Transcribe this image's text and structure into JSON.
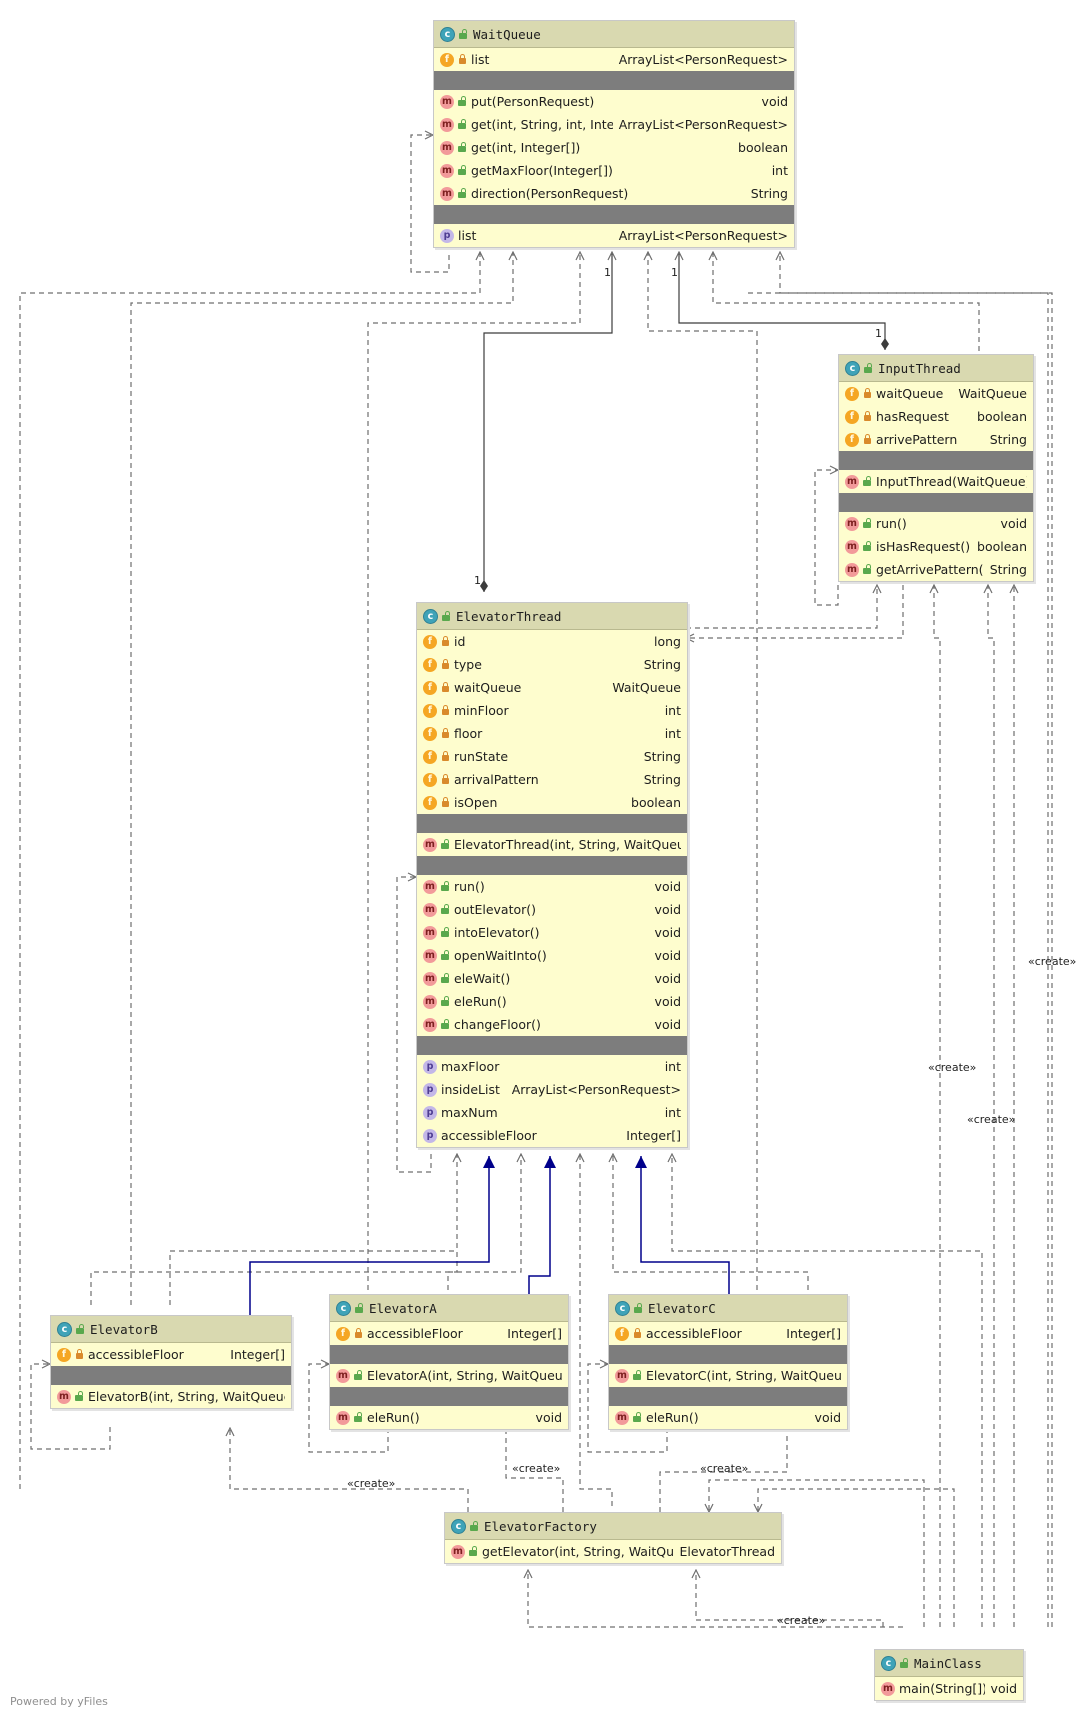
{
  "footer": "Powered by yFiles",
  "classes": {
    "waitqueue": {
      "name": "WaitQueue",
      "fields": [
        {
          "name": "list",
          "type": "ArrayList<PersonRequest>"
        }
      ],
      "methods": [
        {
          "name": "put(PersonRequest)",
          "type": "void"
        },
        {
          "name": "get(int, String, int, Integer[])",
          "type": "ArrayList<PersonRequest>"
        },
        {
          "name": "get(int, Integer[])",
          "type": "boolean"
        },
        {
          "name": "getMaxFloor(Integer[])",
          "type": "int"
        },
        {
          "name": "direction(PersonRequest)",
          "type": "String"
        }
      ],
      "properties": [
        {
          "name": "list",
          "type": "ArrayList<PersonRequest>"
        }
      ]
    },
    "inputthread": {
      "name": "InputThread",
      "fields": [
        {
          "name": "waitQueue",
          "type": "WaitQueue"
        },
        {
          "name": "hasRequest",
          "type": "boolean"
        },
        {
          "name": "arrivePattern",
          "type": "String"
        }
      ],
      "constructors": [
        {
          "name": "InputThread(WaitQueue)",
          "type": ""
        }
      ],
      "methods": [
        {
          "name": "run()",
          "type": "void"
        },
        {
          "name": "isHasRequest()",
          "type": "boolean"
        },
        {
          "name": "getArrivePattern()",
          "type": "String"
        }
      ]
    },
    "elevatorthread": {
      "name": "ElevatorThread",
      "fields": [
        {
          "name": "id",
          "type": "long"
        },
        {
          "name": "type",
          "type": "String"
        },
        {
          "name": "waitQueue",
          "type": "WaitQueue"
        },
        {
          "name": "minFloor",
          "type": "int"
        },
        {
          "name": "floor",
          "type": "int"
        },
        {
          "name": "runState",
          "type": "String"
        },
        {
          "name": "arrivalPattern",
          "type": "String"
        },
        {
          "name": "isOpen",
          "type": "boolean"
        }
      ],
      "constructors": [
        {
          "name": "ElevatorThread(int, String, WaitQueue)",
          "type": ""
        }
      ],
      "methods": [
        {
          "name": "run()",
          "type": "void"
        },
        {
          "name": "outElevator()",
          "type": "void"
        },
        {
          "name": "intoElevator()",
          "type": "void"
        },
        {
          "name": "openWaitInto()",
          "type": "void"
        },
        {
          "name": "eleWait()",
          "type": "void"
        },
        {
          "name": "eleRun()",
          "type": "void"
        },
        {
          "name": "changeFloor()",
          "type": "void"
        }
      ],
      "properties": [
        {
          "name": "maxFloor",
          "type": "int"
        },
        {
          "name": "insideList",
          "type": "ArrayList<PersonRequest>"
        },
        {
          "name": "maxNum",
          "type": "int"
        },
        {
          "name": "accessibleFloor",
          "type": "Integer[]"
        }
      ]
    },
    "elevatorb": {
      "name": "ElevatorB",
      "fields": [
        {
          "name": "accessibleFloor",
          "type": "Integer[]"
        }
      ],
      "constructors": [
        {
          "name": "ElevatorB(int, String, WaitQueue)",
          "type": ""
        }
      ]
    },
    "elevatora": {
      "name": "ElevatorA",
      "fields": [
        {
          "name": "accessibleFloor",
          "type": "Integer[]"
        }
      ],
      "constructors": [
        {
          "name": "ElevatorA(int, String, WaitQueue)",
          "type": ""
        }
      ],
      "methods": [
        {
          "name": "eleRun()",
          "type": "void"
        }
      ]
    },
    "elevatorc": {
      "name": "ElevatorC",
      "fields": [
        {
          "name": "accessibleFloor",
          "type": "Integer[]"
        }
      ],
      "constructors": [
        {
          "name": "ElevatorC(int, String, WaitQueue)",
          "type": ""
        }
      ],
      "methods": [
        {
          "name": "eleRun()",
          "type": "void"
        }
      ]
    },
    "elevatorfactory": {
      "name": "ElevatorFactory",
      "methods": [
        {
          "name": "getElevator(int, String, WaitQueue)",
          "type": "ElevatorThread"
        }
      ]
    },
    "mainclass": {
      "name": "MainClass",
      "methods": [
        {
          "name": "main(String[])",
          "type": "void"
        }
      ]
    }
  },
  "labels": {
    "create": "«create»",
    "one": "1"
  },
  "colors": {
    "class_fill": "#fefdce",
    "class_header": "#d9d9b0",
    "separator": "#7d7d7d",
    "dependency": "#6f6f6f",
    "inheritance": "#00008b",
    "association": "#3c3c3c"
  }
}
